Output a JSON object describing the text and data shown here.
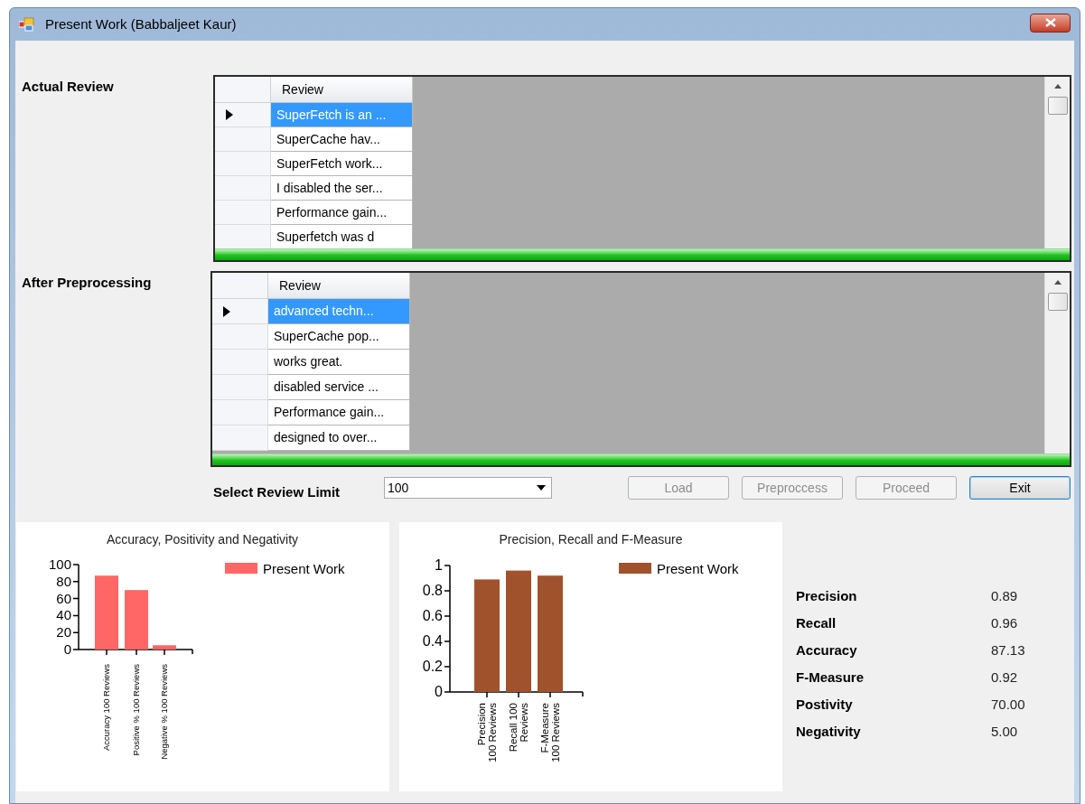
{
  "window": {
    "title": "Present Work (Babbaljeet Kaur)"
  },
  "actual_review": {
    "label": "Actual Review",
    "column": "Review",
    "rows": [
      {
        "text": "SuperFetch is an ...",
        "selected": true
      },
      {
        "text": "SuperCache hav...",
        "selected": false
      },
      {
        "text": "SuperFetch work...",
        "selected": false
      },
      {
        "text": "I disabled the ser...",
        "selected": false
      },
      {
        "text": "Performance gain...",
        "selected": false
      },
      {
        "text": "Superfetch was d",
        "selected": false
      }
    ]
  },
  "after_preprocessing": {
    "label": "After Preprocessing",
    "column": "Review",
    "rows": [
      {
        "text": "advanced techn...",
        "selected": true
      },
      {
        "text": "SuperCache pop...",
        "selected": false
      },
      {
        "text": "works great.",
        "selected": false
      },
      {
        "text": "disabled service ...",
        "selected": false
      },
      {
        "text": "Performance gain...",
        "selected": false
      },
      {
        "text": "designed to over...",
        "selected": false
      }
    ]
  },
  "review_limit": {
    "label": "Select Review Limit",
    "value": "100"
  },
  "buttons": [
    {
      "label": "Load",
      "disabled": true
    },
    {
      "label": "Preproccess",
      "disabled": true
    },
    {
      "label": "Proceed",
      "disabled": true
    },
    {
      "label": "Exit",
      "disabled": false
    }
  ],
  "charts": [
    {
      "chart_data": {
        "type": "bar",
        "title": "Accuracy, Positivity and Negativity",
        "categories": [
          "Accuracy 100 Reviews",
          "Positive % 100 Reviews",
          "Negative % 100 Reviews"
        ],
        "series": [
          {
            "name": "Present Work",
            "color": "#ff6666",
            "values": [
              87,
              70,
              5
            ]
          }
        ],
        "ylim": [
          0,
          100
        ],
        "yticks": [
          0,
          20,
          40,
          60,
          80,
          100
        ]
      }
    },
    {
      "chart_data": {
        "type": "bar",
        "title": "Precision, Recall and F-Measure",
        "categories": [
          "Precision 100 Reviews",
          "Recall 100 Reviews",
          "F-Measure 100 Reviews"
        ],
        "series": [
          {
            "name": "Present Work",
            "color": "#a0522d",
            "values": [
              0.89,
              0.96,
              0.92
            ]
          }
        ],
        "ylim": [
          0,
          1
        ],
        "yticks": [
          0,
          0.2,
          0.4,
          0.6,
          0.8,
          1
        ]
      }
    }
  ],
  "metrics": [
    {
      "label": "Precision",
      "value": "0.89"
    },
    {
      "label": "Recall",
      "value": "0.96"
    },
    {
      "label": "Accuracy",
      "value": "87.13"
    },
    {
      "label": "F-Measure",
      "value": "0.92"
    },
    {
      "label": "Postivity",
      "value": "70.00"
    },
    {
      "label": "Negativity",
      "value": "5.00"
    }
  ]
}
